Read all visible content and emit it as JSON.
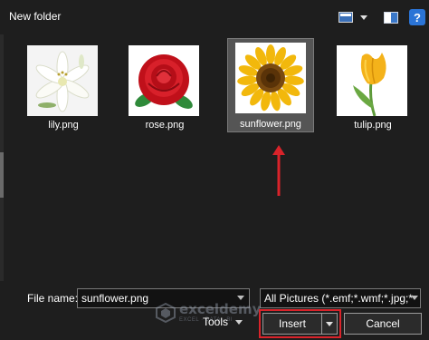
{
  "toolbar": {
    "new_folder_label": "New folder",
    "help_label": "?"
  },
  "files": [
    {
      "name": "lily.png",
      "selected": false
    },
    {
      "name": "rose.png",
      "selected": false
    },
    {
      "name": "sunflower.png",
      "selected": true
    },
    {
      "name": "tulip.png",
      "selected": false
    }
  ],
  "bottom": {
    "file_name_label": "File name:",
    "file_name_value": "sunflower.png",
    "filter_value": "All Pictures (*.emf;*.wmf;*.jpg;*",
    "tools_label": "Tools",
    "insert_label": "Insert",
    "cancel_label": "Cancel"
  },
  "watermark": {
    "name": "exceldemy",
    "tagline": "EXCEL · DATA · BI"
  },
  "colors": {
    "background": "#1e1e1e",
    "selection": "#555555",
    "highlight_red": "#d9232a",
    "accent_blue": "#2b74d6"
  }
}
